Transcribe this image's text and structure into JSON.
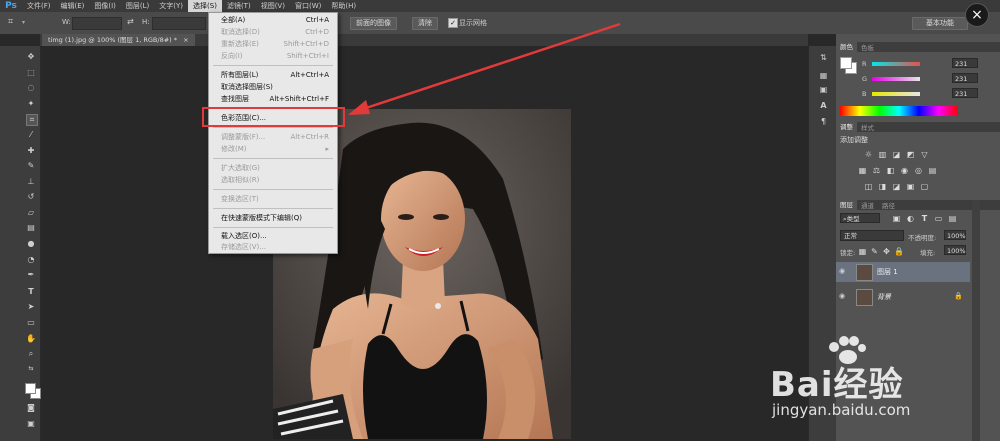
{
  "app": {
    "logo": "Ps"
  },
  "menubar": {
    "items": [
      "文件(F)",
      "编辑(E)",
      "图像(I)",
      "图层(L)",
      "文字(Y)",
      "选择(S)",
      "滤镜(T)",
      "视图(V)",
      "窗口(W)",
      "帮助(H)"
    ],
    "active_index": 5
  },
  "options": {
    "w_label": "W:",
    "h_label": "H:",
    "btn_front_image": "前面的图像",
    "btn_clear": "清除",
    "show_grid": "显示网格",
    "workspace": "基本功能"
  },
  "tab": {
    "title": "timg (1).jpg @ 100% (图层 1, RGB/8#) *",
    "close": "×"
  },
  "dropdown": {
    "items": [
      {
        "label": "全部(A)",
        "shortcut": "Ctrl+A",
        "disabled": false
      },
      {
        "label": "取消选择(D)",
        "shortcut": "Ctrl+D",
        "disabled": true
      },
      {
        "label": "重新选择(E)",
        "shortcut": "Shift+Ctrl+D",
        "disabled": true
      },
      {
        "label": "反向(I)",
        "shortcut": "Shift+Ctrl+I",
        "disabled": true
      },
      {
        "label": "所有图层(L)",
        "shortcut": "Alt+Ctrl+A",
        "disabled": false
      },
      {
        "label": "取消选择图层(S)",
        "shortcut": "",
        "disabled": false
      },
      {
        "label": "查找图层",
        "shortcut": "Alt+Shift+Ctrl+F",
        "disabled": false
      },
      {
        "label": "色彩范围(C)...",
        "shortcut": "",
        "disabled": false
      },
      {
        "label": "调整蒙版(F)...",
        "shortcut": "Alt+Ctrl+R",
        "disabled": true
      },
      {
        "label": "修改(M)",
        "shortcut": "▸",
        "disabled": true
      },
      {
        "label": "扩大选取(G)",
        "shortcut": "",
        "disabled": true
      },
      {
        "label": "选取相似(R)",
        "shortcut": "",
        "disabled": true
      },
      {
        "label": "变换选区(T)",
        "shortcut": "",
        "disabled": true
      },
      {
        "label": "在快速蒙版模式下编辑(Q)",
        "shortcut": "",
        "disabled": false
      },
      {
        "label": "载入选区(O)...",
        "shortcut": "",
        "disabled": false
      },
      {
        "label": "存储选区(V)...",
        "shortcut": "",
        "disabled": true
      }
    ]
  },
  "color_panel": {
    "tabs": [
      "颜色",
      "色板"
    ],
    "channels": [
      {
        "name": "R",
        "value": "231",
        "color": "#e8504c"
      },
      {
        "name": "G",
        "value": "231",
        "color": "#d45ad4"
      },
      {
        "name": "B",
        "value": "231",
        "color": "#e0d85a"
      }
    ]
  },
  "adjust_panel": {
    "tabs": [
      "调整",
      "样式"
    ],
    "title": "添加调整"
  },
  "layers_panel": {
    "tabs": [
      "图层",
      "通道",
      "路径"
    ],
    "kind": "类型",
    "blend_mode": "正常",
    "opacity_label": "不透明度:",
    "opacity_value": "100%",
    "lock_label": "锁定:",
    "fill_label": "填充:",
    "fill_value": "100%",
    "layers": [
      {
        "name": "图层 1",
        "selected": true
      },
      {
        "name": "背景",
        "selected": false,
        "locked": true
      }
    ]
  },
  "watermark": {
    "brand": "Bai经验",
    "url": "jingyan.baidu.com"
  },
  "colors": {
    "accent": "#4aa6e8",
    "highlight": "#e23a3a",
    "panel": "#535353"
  }
}
